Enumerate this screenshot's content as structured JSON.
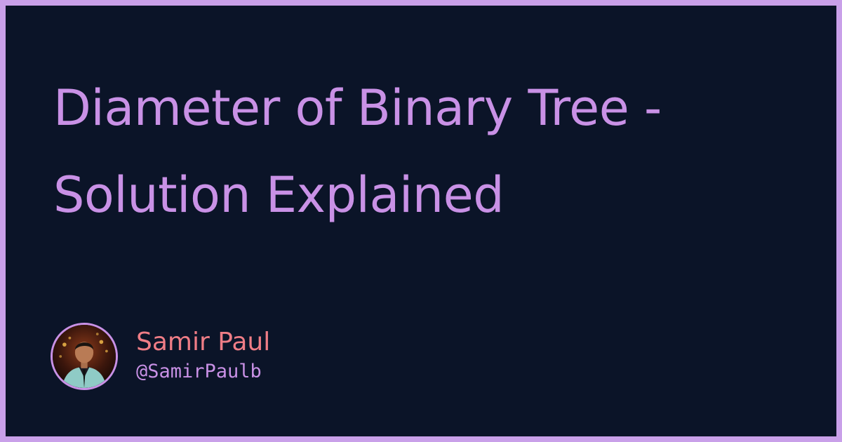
{
  "title": "Diameter of Binary Tree - Solution Explained",
  "author": {
    "name": "Samir Paul",
    "handle": "@SamirPaulb",
    "avatar_icon": "avatar-photo"
  },
  "colors": {
    "border": "#c9a0e9",
    "background": "#0b1428",
    "title": "#c991e6",
    "name": "#ef7d86",
    "handle": "#c991e6"
  }
}
